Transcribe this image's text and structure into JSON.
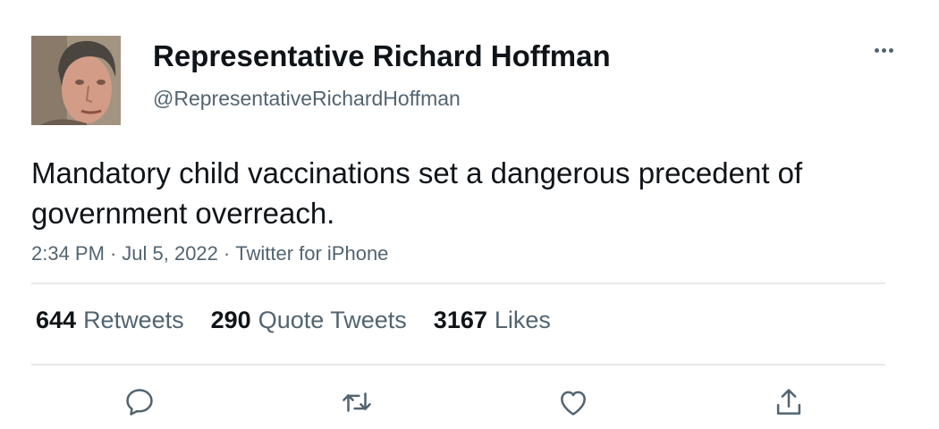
{
  "author": {
    "name": "Representative Richard Hoffman",
    "handle": "@RepresentativeRichardHoffman"
  },
  "tweet": {
    "text": "Mandatory child vaccinations set a dangerous precedent of government overreach.",
    "time": "2:34 PM",
    "date": "Jul 5, 2022",
    "source": "Twitter for iPhone",
    "separator": "·"
  },
  "stats": {
    "retweets": {
      "count": "644",
      "label": "Retweets"
    },
    "quotes": {
      "count": "290",
      "label": "Quote Tweets"
    },
    "likes": {
      "count": "3167",
      "label": "Likes"
    }
  },
  "actions": [
    "reply-icon",
    "retweet-icon",
    "like-icon",
    "share-icon"
  ],
  "colors": {
    "text": "#0f1419",
    "secondary": "#536471",
    "divider": "#e7e9ea"
  }
}
